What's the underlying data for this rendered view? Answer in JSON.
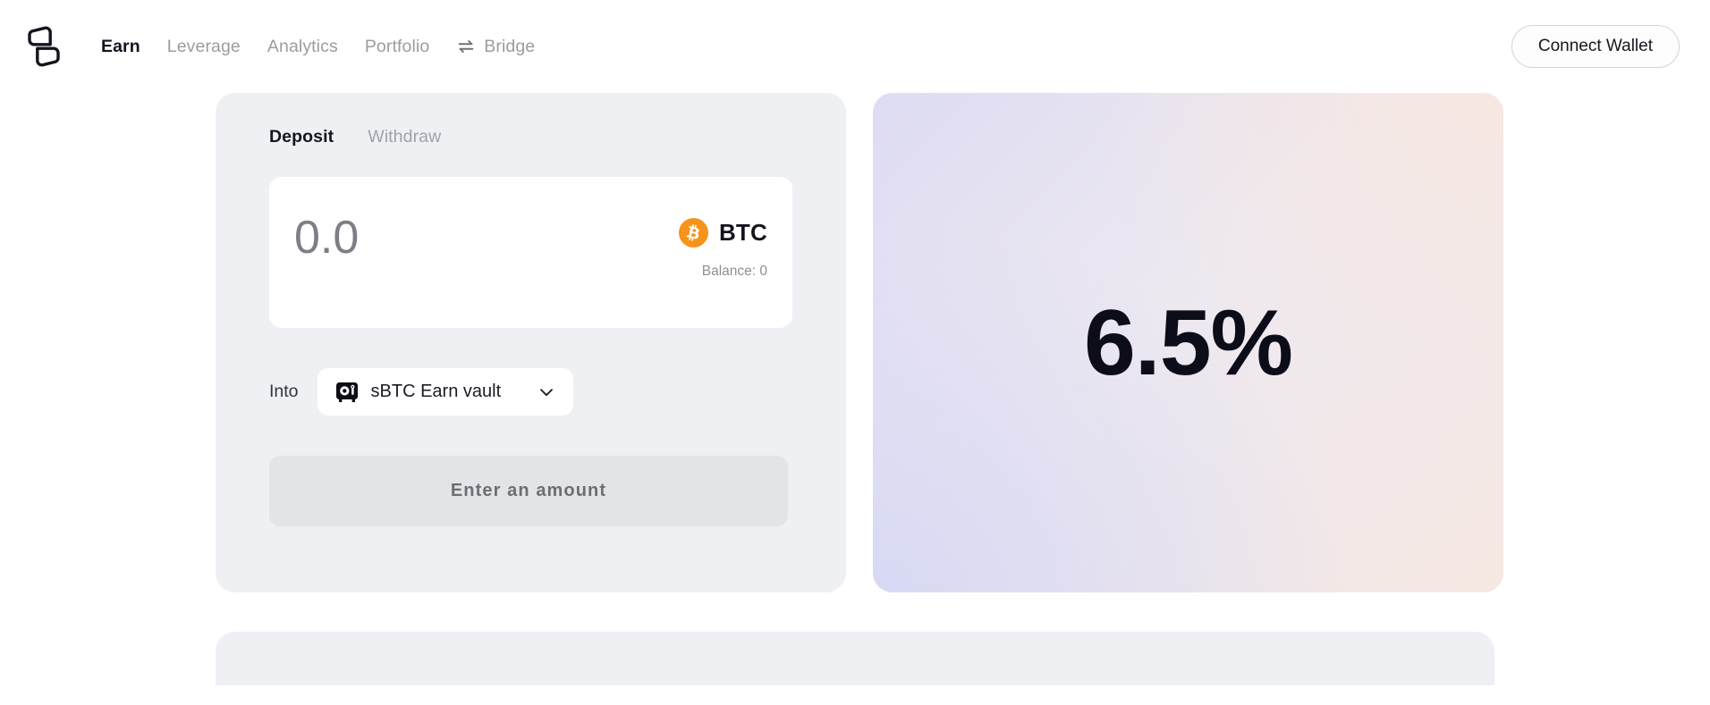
{
  "header": {
    "logo_icon": "propeller-logo-icon",
    "nav": [
      {
        "label": "Earn",
        "active": true,
        "icon": null
      },
      {
        "label": "Leverage",
        "active": false,
        "icon": null
      },
      {
        "label": "Analytics",
        "active": false,
        "icon": null
      },
      {
        "label": "Portfolio",
        "active": false,
        "icon": null
      },
      {
        "label": "Bridge",
        "active": false,
        "icon": "swap-arrows-icon"
      }
    ],
    "connect_wallet_label": "Connect Wallet"
  },
  "deposit_card": {
    "tabs": [
      {
        "label": "Deposit",
        "active": true
      },
      {
        "label": "Withdraw",
        "active": false
      }
    ],
    "amount": {
      "value": "",
      "placeholder": "0.0",
      "token_symbol": "BTC",
      "token_icon": "bitcoin-icon",
      "balance_label": "Balance: 0"
    },
    "destination": {
      "label": "Into",
      "vault_icon": "vault-safe-icon",
      "selected": "sBTC Earn vault",
      "chevron_icon": "chevron-down-icon"
    },
    "cta_label": "Enter an amount"
  },
  "apy_card": {
    "value": "6.5%",
    "gradient_from": "#dedcf3",
    "gradient_to": "#f6e8e2"
  },
  "colors": {
    "card_bg": "#eff0f4",
    "page_bg": "#ffffff",
    "text_primary": "#14141f",
    "text_muted": "#9a9ca3",
    "bitcoin_orange": "#f7931a",
    "cta_bg": "#e3e4e6"
  }
}
